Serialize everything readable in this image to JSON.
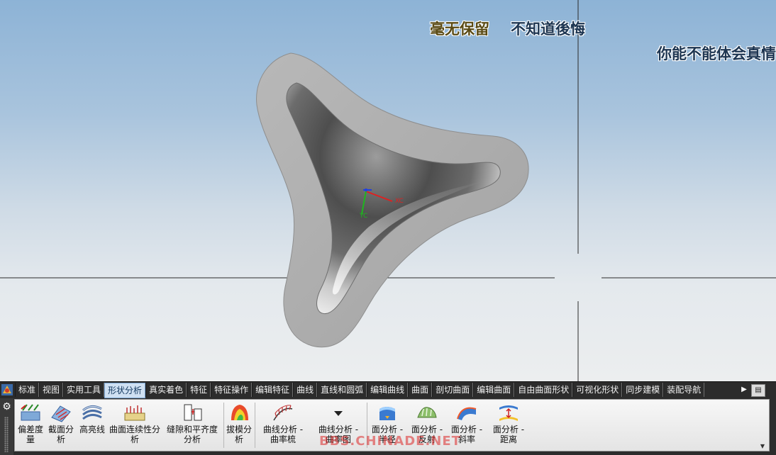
{
  "overlay": {
    "line1a": "毫无保留",
    "line1b": "不知道後悔",
    "line2": "你能不能体会真情"
  },
  "axes": {
    "xc": "XC",
    "yc": "YC"
  },
  "tabs": [
    {
      "label": "标准",
      "active": false
    },
    {
      "label": "视图",
      "active": false
    },
    {
      "label": "实用工具",
      "active": false
    },
    {
      "label": "形状分析",
      "active": true
    },
    {
      "label": "真实着色",
      "active": false
    },
    {
      "label": "特征",
      "active": false
    },
    {
      "label": "特征操作",
      "active": false
    },
    {
      "label": "编辑特征",
      "active": false
    },
    {
      "label": "曲线",
      "active": false
    },
    {
      "label": "直线和圆弧",
      "active": false
    },
    {
      "label": "编辑曲线",
      "active": false
    },
    {
      "label": "曲面",
      "active": false
    },
    {
      "label": "剖切曲面",
      "active": false
    },
    {
      "label": "编辑曲面",
      "active": false
    },
    {
      "label": "自由曲面形状",
      "active": false
    },
    {
      "label": "可视化形状",
      "active": false
    },
    {
      "label": "同步建模",
      "active": false
    },
    {
      "label": "装配导航",
      "active": false
    }
  ],
  "tools": {
    "t1": {
      "l1": "偏差度",
      "l2": "量"
    },
    "t2": {
      "l1": "截面分",
      "l2": "析"
    },
    "t3": {
      "l1": "高亮线",
      "l2": ""
    },
    "t4": {
      "l1": "曲面连续性分",
      "l2": "析"
    },
    "t5": {
      "l1": "缝隙和平齐度",
      "l2": "分析"
    },
    "t6": {
      "l1": "拔模分",
      "l2": "析"
    },
    "t7": {
      "l1": "曲线分析 -",
      "l2": "曲率梳"
    },
    "t8": {
      "l1": "曲线分析 -",
      "l2": "曲率图"
    },
    "t9": {
      "l1": "面分析 -",
      "l2": "半径"
    },
    "t10": {
      "l1": "面分析 -",
      "l2": "反射"
    },
    "t11": {
      "l1": "面分析 -",
      "l2": "斜率"
    },
    "t12": {
      "l1": "面分析 -",
      "l2": "距离"
    }
  },
  "watermark": "BBS.CHINADE.NET",
  "colors": {
    "active_tab": "#cfe0f2",
    "toolbar_bg": "#2c2c2c",
    "viewport_top": "#8db3d6",
    "viewport_bottom": "#eceeef"
  }
}
